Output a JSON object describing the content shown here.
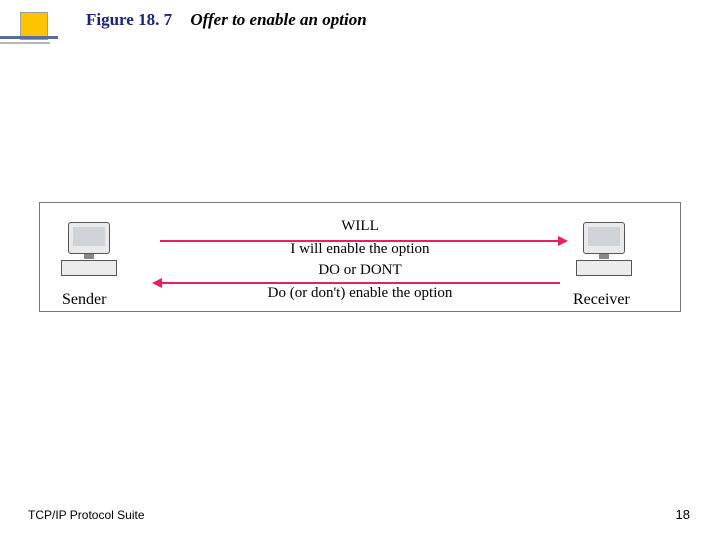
{
  "title": {
    "figure_number": "Figure 18. 7",
    "caption": "Offer to enable an option"
  },
  "diagram": {
    "sender_label": "Sender",
    "receiver_label": "Receiver",
    "top_command": "WILL",
    "top_text": "I will enable the option",
    "bottom_command": "DO or DONT",
    "bottom_text": "Do (or don't) enable the option"
  },
  "footer": {
    "left": "TCP/IP Protocol Suite",
    "page_number": "18"
  }
}
